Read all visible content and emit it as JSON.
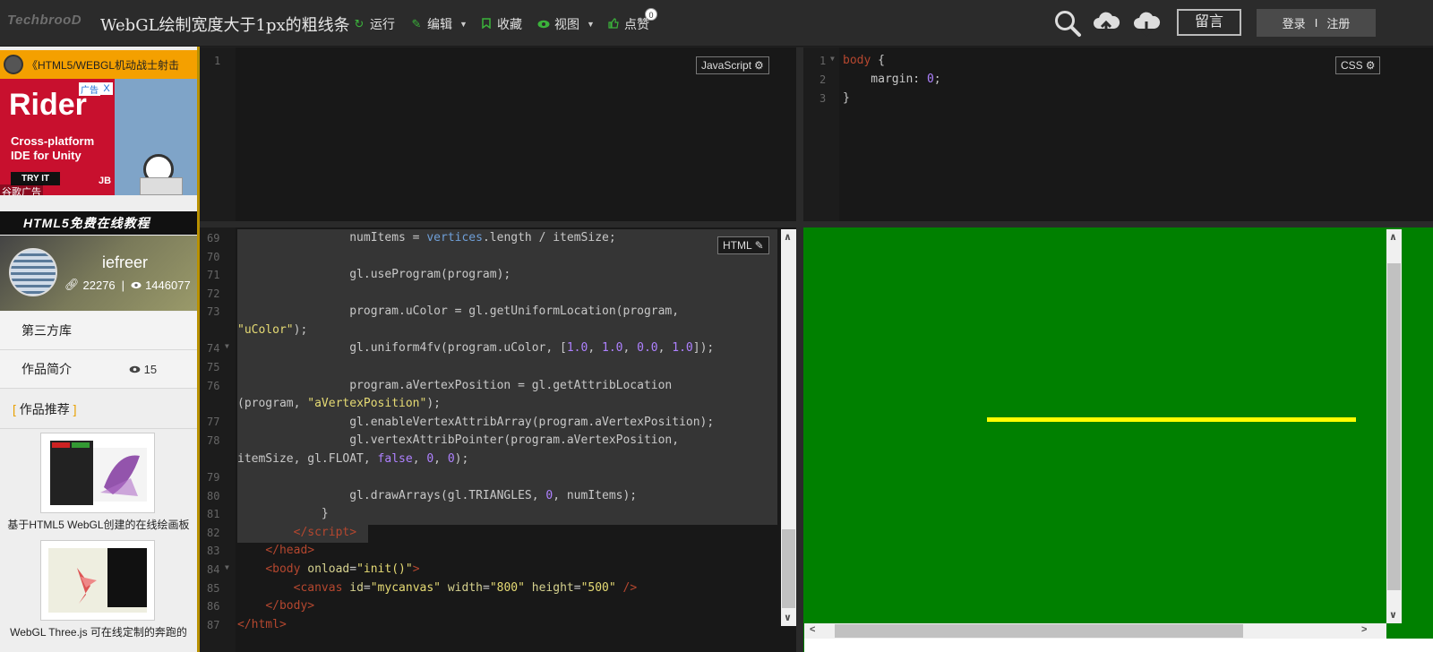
{
  "app": {
    "logo": "TechbrooD",
    "title": "WebGL绘制宽度大于1px的粗线条"
  },
  "toolbar": {
    "run": "运行",
    "edit": "编辑",
    "favorite": "收藏",
    "view": "视图",
    "like": "点赞",
    "like_count": "0",
    "message": "留言",
    "login": "登录",
    "separator": "I",
    "register": "注册"
  },
  "sidebar": {
    "top_link": "《HTML5/WEBGL机动战士射击",
    "ad": {
      "label": "广告",
      "close": "X",
      "headline": "Rider",
      "sub1": "Cross-platform",
      "sub2": "IDE for Unity",
      "cta": "TRY IT",
      "brand": "JB",
      "source": "谷歌广告"
    },
    "banner": "HTML5免费在线教程",
    "user": {
      "name": "iefreer",
      "links": "22276",
      "sep": "|",
      "views": "1446077"
    },
    "menu": {
      "third_party": "第三方库",
      "intro": "作品简介",
      "intro_views": "15",
      "recommend_open": "[",
      "recommend": "作品推荐",
      "recommend_close": "]"
    },
    "recommendations": [
      {
        "caption": "基于HTML5 WebGL创建的在线绘画板"
      },
      {
        "caption": "WebGL Three.js 可在线定制的奔跑的"
      }
    ]
  },
  "editors": {
    "js": {
      "lang": "JavaScript",
      "lines": [
        "1"
      ]
    },
    "css": {
      "lang": "CSS",
      "lines": [
        "1",
        "2",
        "3"
      ],
      "code": {
        "l1a": "body",
        "l1b": " {",
        "l2a": "    margin",
        "l2b": ": ",
        "l2c": "0",
        "l2d": ";",
        "l3": "}"
      }
    },
    "html": {
      "lang": "HTML",
      "line_numbers": [
        "69",
        "70",
        "71",
        "72",
        "73",
        "",
        "74",
        "75",
        "76",
        "",
        "77",
        "78",
        "",
        "79",
        "80",
        "81",
        "82",
        "83",
        "84",
        "85",
        "86",
        "87"
      ]
    }
  },
  "colors": {
    "preview_bg": "#008000",
    "line_color": "#ffff00"
  }
}
